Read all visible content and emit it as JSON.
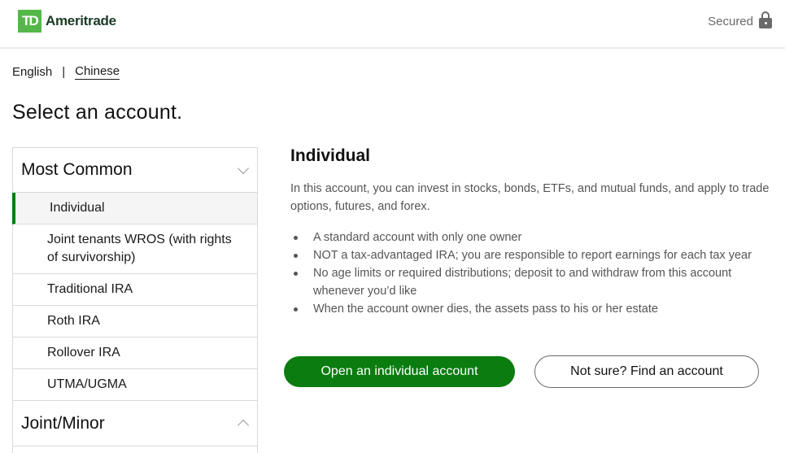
{
  "header": {
    "logo_mark": "TD",
    "logo_text": "Ameritrade",
    "secured_label": "Secured",
    "lock_icon": "lock-icon"
  },
  "language": {
    "options": [
      "English",
      "Chinese"
    ],
    "separator": "|",
    "current": "English"
  },
  "page_title": "Select an account.",
  "account_groups": [
    {
      "title": "Most Common",
      "expanded": true,
      "chevron_icon": "chevron-down-icon",
      "items": [
        {
          "label": "Individual",
          "selected": true
        },
        {
          "label": "Joint tenants WROS (with rights of survivorship)",
          "selected": false
        },
        {
          "label": "Traditional IRA",
          "selected": false
        },
        {
          "label": "Roth IRA",
          "selected": false
        },
        {
          "label": "Rollover IRA",
          "selected": false
        },
        {
          "label": "UTMA/UGMA",
          "selected": false
        }
      ]
    },
    {
      "title": "Joint/Minor",
      "expanded": false,
      "chevron_icon": "chevron-up-icon",
      "items": []
    }
  ],
  "detail": {
    "title": "Individual",
    "description": "In this account, you can invest in stocks, bonds, ETFs, and mutual funds, and apply to trade options, futures, and forex.",
    "bullets": [
      "A standard account with only one owner",
      "NOT a tax-advantaged IRA; you are responsible to report earnings for each tax year",
      "No age limits or required distributions; deposit to and withdraw from this account whenever you’d like",
      "When the account owner dies, the assets pass to his or her estate"
    ]
  },
  "actions": {
    "primary_label": "Open an individual account",
    "secondary_label": "Not sure? Find an account"
  },
  "colors": {
    "brand_green": "#0a7c10",
    "logo_green": "#54b848",
    "logo_text": "#1b3a26"
  }
}
